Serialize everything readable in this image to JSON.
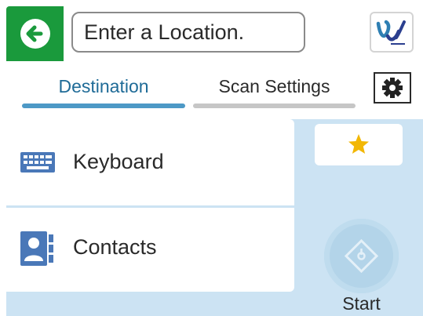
{
  "header": {
    "back_icon": "arrow-left-icon",
    "location_placeholder": "Enter a Location.",
    "location_value": "",
    "logo_icon": "epson-connect-logo-icon"
  },
  "tabs": [
    {
      "label": "Destination",
      "active": true
    },
    {
      "label": "Scan Settings",
      "active": false
    }
  ],
  "settings_icon": "gear-icon",
  "destinations": [
    {
      "label": "Keyboard",
      "icon": "keyboard-icon"
    },
    {
      "label": "Contacts",
      "icon": "contacts-icon"
    }
  ],
  "favorite_icon": "star-icon",
  "start": {
    "label": "Start",
    "enabled": false
  },
  "colors": {
    "accent": "#1a9a3c",
    "tab_active": "#1f6b97",
    "panel_background": "#cce3f3",
    "star": "#f2b705"
  }
}
